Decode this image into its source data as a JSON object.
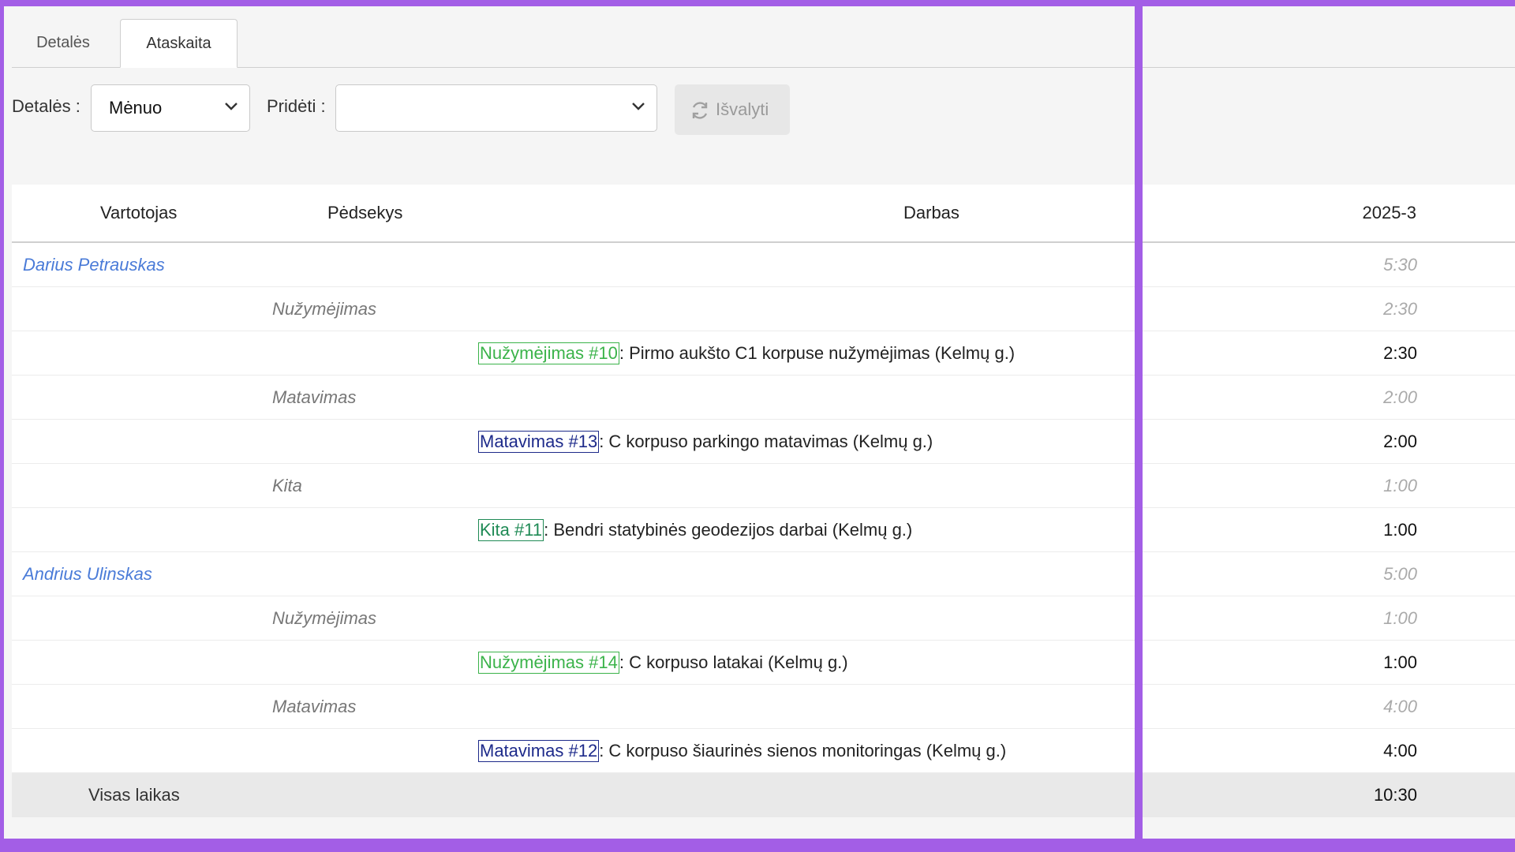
{
  "tabs": [
    {
      "label": "Detalės",
      "active": false
    },
    {
      "label": "Ataskaita",
      "active": true
    }
  ],
  "toolbar": {
    "detales_label": "Detalės :",
    "detales_value": "Mėnuo",
    "prideti_label": "Pridėti :",
    "prideti_value": "",
    "clear_label": "Išvalyti"
  },
  "table": {
    "headers": {
      "user": "Vartotojas",
      "tracker": "Pėdsekys",
      "work": "Darbas",
      "period": "2025-3"
    },
    "rows": [
      {
        "type": "user",
        "text": "Darius Petrauskas",
        "time": "5:30"
      },
      {
        "type": "category",
        "text": "Nužymėjimas",
        "time": "2:30"
      },
      {
        "type": "task",
        "tag": "Nužymėjimas #10",
        "tag_kind": "nuz",
        "text": ": Pirmo aukšto C1 korpuse nužymėjimas (Kelmų g.)",
        "time": "2:30"
      },
      {
        "type": "category",
        "text": "Matavimas",
        "time": "2:00"
      },
      {
        "type": "task",
        "tag": "Matavimas #13",
        "tag_kind": "mat",
        "text": ": C korpuso parkingo matavimas (Kelmų g.)",
        "time": "2:00"
      },
      {
        "type": "category",
        "text": "Kita",
        "time": "1:00"
      },
      {
        "type": "task",
        "tag": "Kita #11",
        "tag_kind": "kita",
        "text": ": Bendri statybinės geodezijos darbai (Kelmų g.)",
        "time": "1:00"
      },
      {
        "type": "user",
        "text": "Andrius Ulinskas",
        "time": "5:00"
      },
      {
        "type": "category",
        "text": "Nužymėjimas",
        "time": "1:00"
      },
      {
        "type": "task",
        "tag": "Nužymėjimas #14",
        "tag_kind": "nuz",
        "text": ": C korpuso latakai (Kelmų g.)",
        "time": "1:00"
      },
      {
        "type": "category",
        "text": "Matavimas",
        "time": "4:00"
      },
      {
        "type": "task",
        "tag": "Matavimas #12",
        "tag_kind": "mat",
        "text": ": C korpuso šiaurinės sienos monitoringas (Kelmų g.)",
        "time": "4:00"
      }
    ],
    "total": {
      "label": "Visas laikas",
      "time": "10:30"
    }
  },
  "colors": {
    "frame": "#a35ee6",
    "user_link": "#4a7bd8",
    "tag_nuz": "#3bb34a",
    "tag_mat": "#1d2a8a",
    "tag_kita": "#1f8a55"
  }
}
